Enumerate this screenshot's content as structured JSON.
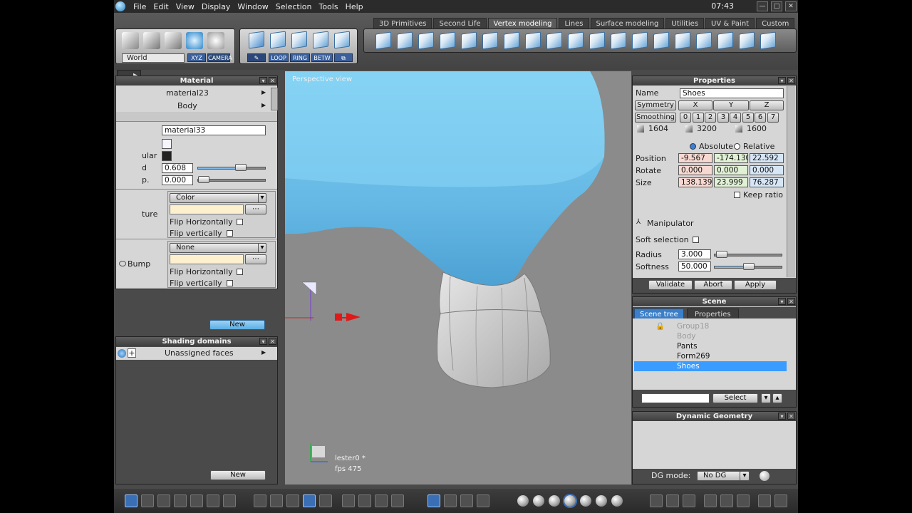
{
  "menu": [
    "File",
    "Edit",
    "View",
    "Display",
    "Window",
    "Selection",
    "Tools",
    "Help"
  ],
  "clock": "07:43",
  "window_controls": [
    "—",
    "□",
    "✕"
  ],
  "tabs": [
    {
      "label": "3D Primitives",
      "active": false
    },
    {
      "label": "Second Life",
      "active": false
    },
    {
      "label": "Vertex modeling",
      "active": true
    },
    {
      "label": "Lines",
      "active": false
    },
    {
      "label": "Surface modeling",
      "active": false
    },
    {
      "label": "Utilities",
      "active": false
    },
    {
      "label": "UV & Paint",
      "active": false
    },
    {
      "label": "Custom",
      "active": false
    }
  ],
  "toolbar": {
    "space_select": "World",
    "xyz": "XYZ",
    "camera": "CAMERA",
    "loop": "LOOP",
    "ring": "RING",
    "betw": "BETW"
  },
  "material_panel": {
    "title": "Material",
    "material_name": "material23",
    "object": "Body",
    "name_field": "material33",
    "specular_label": "ular",
    "diffuse_label": "d",
    "value1": "0.608",
    "value1_fraction": 0.6,
    "value2": "0.000",
    "value2_label": "p.",
    "texture": {
      "label": "ture",
      "select": "Color",
      "flip_h": "Flip Horizontally",
      "flip_v": "Flip vertically"
    },
    "bump": {
      "label": "Bump",
      "select": "None",
      "flip_h": "Flip Horizontally",
      "flip_v": "Flip vertically"
    },
    "new_button": "New"
  },
  "shading_panel": {
    "title": "Shading domains",
    "item": "Unassigned faces",
    "new_button": "New"
  },
  "viewport": {
    "label": "Perspective view",
    "object_name": "lester0 *",
    "fps": "fps 475"
  },
  "properties_panel": {
    "title": "Properties",
    "name_label": "Name",
    "name_value": "Shoes",
    "symmetry_label": "Symmetry",
    "sym_axes": [
      "X",
      "Y",
      "Z"
    ],
    "smoothing_label": "Smoothing",
    "smoothing_levels": [
      "0",
      "1",
      "2",
      "3",
      "4",
      "5",
      "6",
      "7"
    ],
    "counts": [
      "1604",
      "3200",
      "1600"
    ],
    "absolute": "Absolute",
    "relative": "Relative",
    "position_label": "Position",
    "position": [
      "-9.567",
      "-174.130",
      "22.592"
    ],
    "rotate_label": "Rotate",
    "rotate": [
      "0.000",
      "0.000",
      "0.000"
    ],
    "size_label": "Size",
    "size": [
      "138.139",
      "23.999",
      "76.287"
    ],
    "keep_ratio": "Keep ratio",
    "manipulator": "Manipulator",
    "soft_selection": "Soft selection",
    "radius_label": "Radius",
    "radius": "3.000",
    "softness_label": "Softness",
    "softness": "50.000",
    "validate": "Validate",
    "abort": "Abort",
    "apply": "Apply"
  },
  "scene_panel": {
    "title": "Scene",
    "tabs": [
      "Scene tree",
      "Properties"
    ],
    "items": [
      {
        "label": "Group18",
        "state": "dim"
      },
      {
        "label": "Body",
        "state": "dim"
      },
      {
        "label": "Pants",
        "state": "normal"
      },
      {
        "label": "Form269",
        "state": "normal"
      },
      {
        "label": "Shoes",
        "state": "selected"
      }
    ],
    "select_button": "Select"
  },
  "dynamic_geometry": {
    "title": "Dynamic Geometry",
    "dg_mode_label": "DG mode:",
    "dg_mode": "No DG"
  },
  "colors": {
    "accent": "#3b9cff",
    "shoe_blue": "#6fbfe8",
    "panel_bg": "#d6d6d6"
  }
}
